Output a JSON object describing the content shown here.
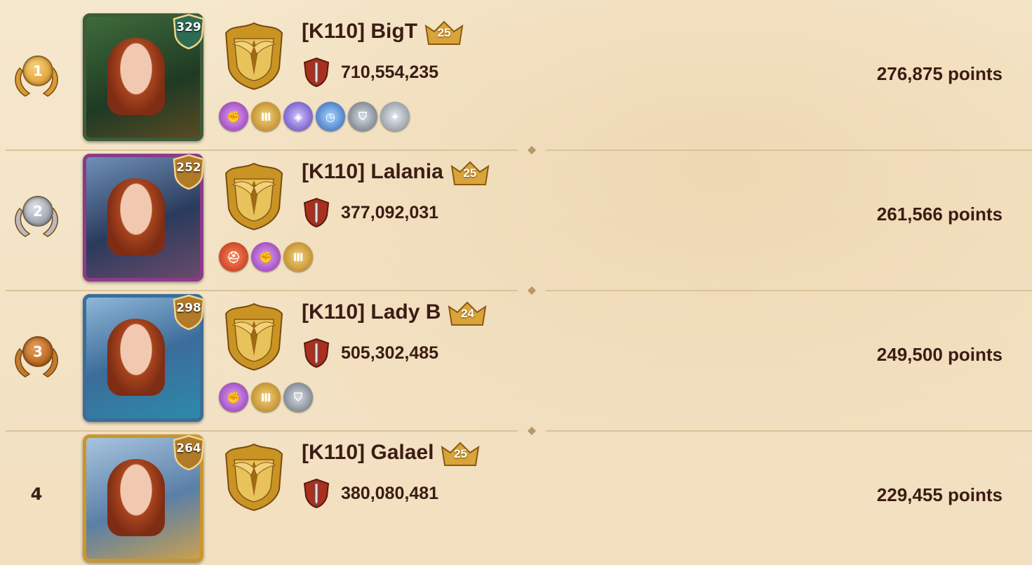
{
  "colors": {
    "background": "#f3e3c6",
    "text": "#3b1c14",
    "gold": "#d9a53a",
    "silver": "#b8bcc2",
    "bronze": "#c27a2c",
    "level_shield_green": "#2e6b52",
    "level_shield_gold": "#b07a28"
  },
  "entries": [
    {
      "rank": "1",
      "rank_style": "gold",
      "level": "329",
      "name": "[K110] BigT",
      "crown_level": "25",
      "power": "710,554,235",
      "points": "276,875 points",
      "avatar_theme": "green",
      "badges": [
        "fist-purple",
        "pillars-gold",
        "helmet-violet",
        "stopwatch-blue",
        "shield-steel",
        "armored-arm-steel"
      ]
    },
    {
      "rank": "2",
      "rank_style": "silver",
      "level": "252",
      "name": "[K110] Lalania",
      "crown_level": "25",
      "power": "377,092,031",
      "points": "261,566 points",
      "avatar_theme": "flowers",
      "badges": [
        "spartan-helmet-red",
        "fist-purple",
        "pillars-gold"
      ]
    },
    {
      "rank": "3",
      "rank_style": "bronze",
      "level": "298",
      "name": "[K110] Lady B",
      "crown_level": "24",
      "power": "505,302,485",
      "points": "249,500 points",
      "avatar_theme": "ships",
      "badges": [
        "fist-purple",
        "pillars-gold",
        "shield-steel"
      ]
    },
    {
      "rank": "4",
      "rank_style": "plain",
      "level": "264",
      "name": "[K110] Galael",
      "crown_level": "25",
      "power": "380,080,481",
      "points": "229,455 points",
      "avatar_theme": "gold-frame",
      "badges": []
    }
  ]
}
